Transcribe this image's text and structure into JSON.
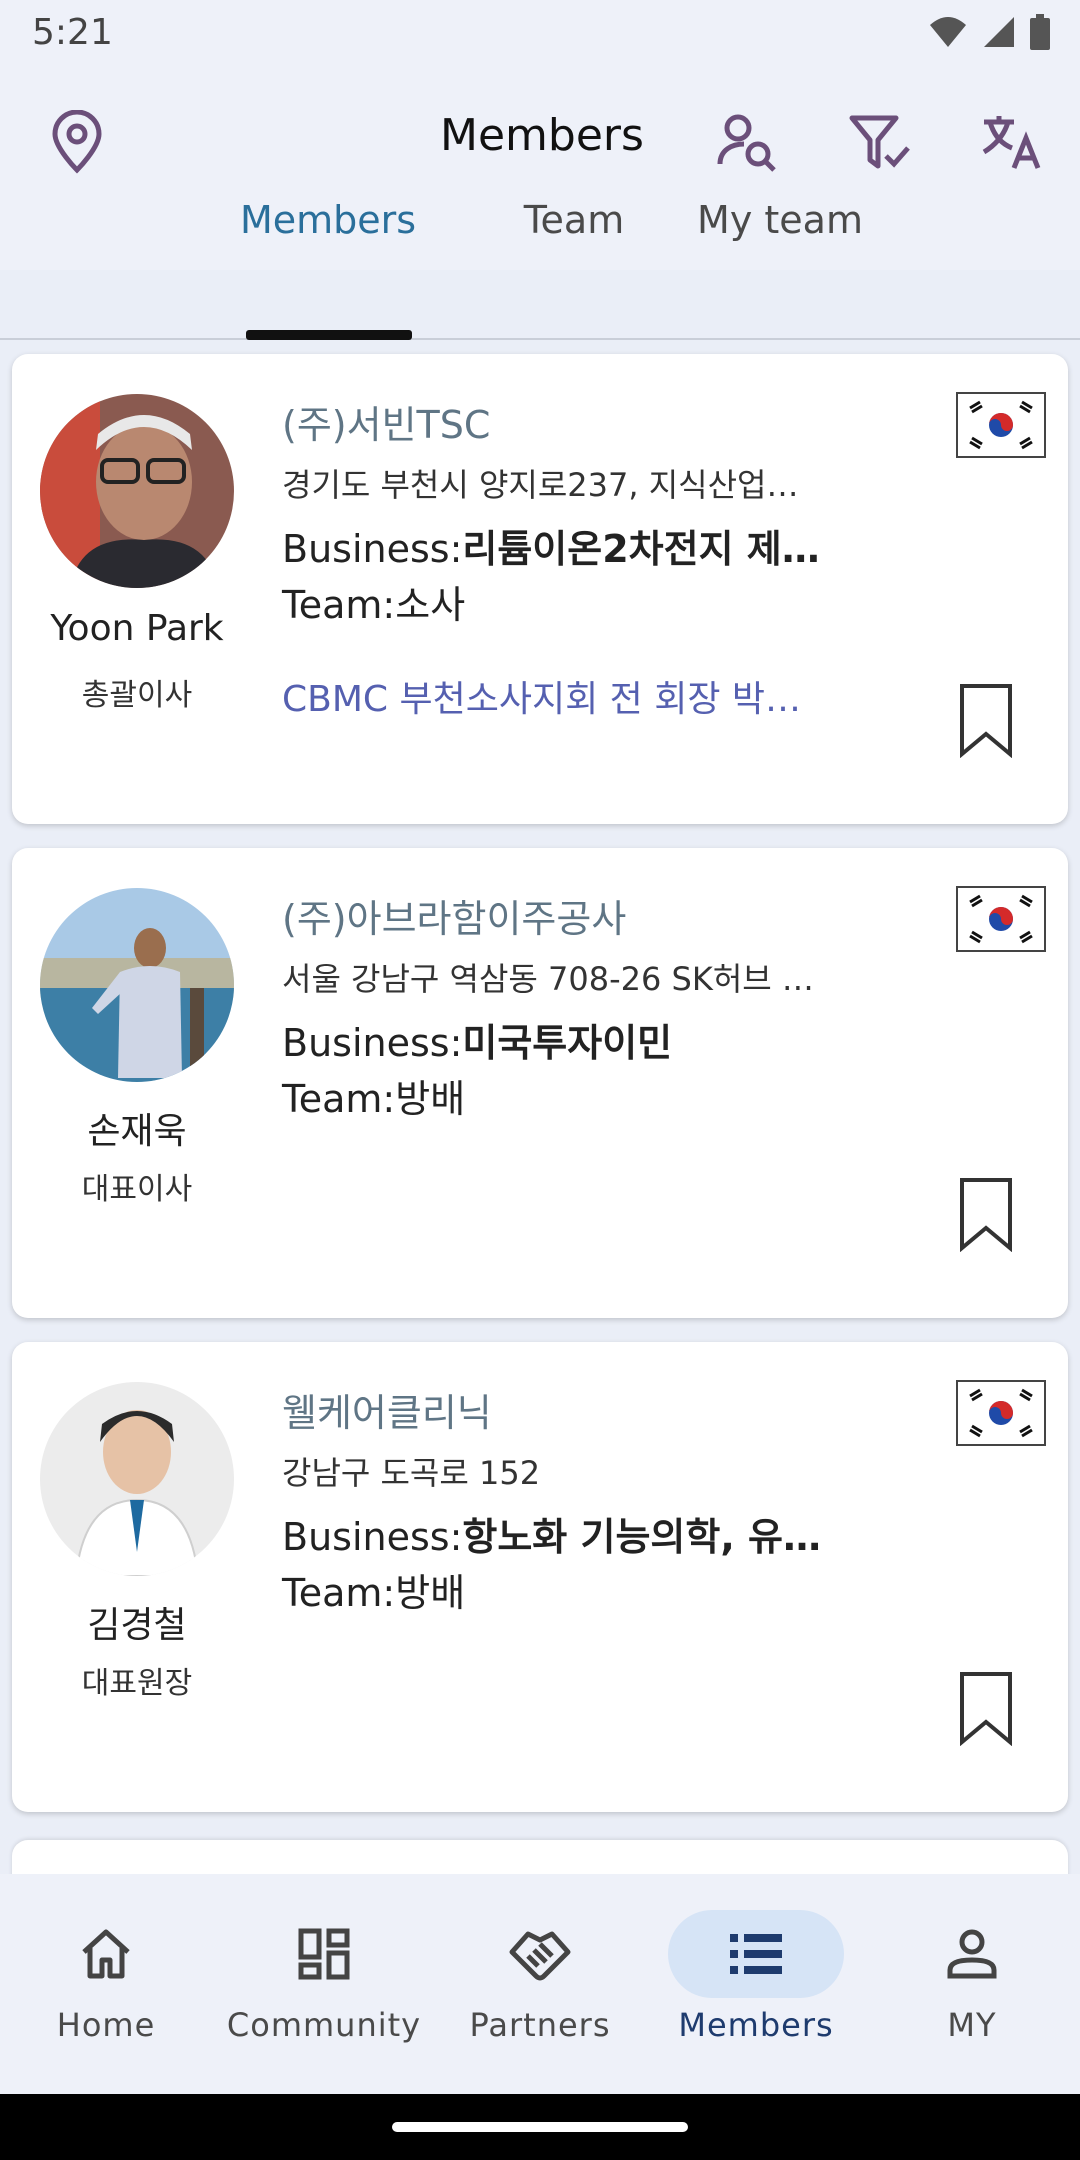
{
  "status_bar": {
    "time": "5:21",
    "icons": [
      "wifi-icon",
      "signal-icon",
      "battery-icon"
    ]
  },
  "app_bar": {
    "title": "Members",
    "actions": [
      "location-pin-icon",
      "person-search-icon",
      "filter-check-icon",
      "translate-icon"
    ]
  },
  "tabs": [
    {
      "label": "Members",
      "active": true
    },
    {
      "label": "Team",
      "active": false
    },
    {
      "label": "My team",
      "active": false
    }
  ],
  "members": [
    {
      "name": "Yoon Park",
      "role": "총괄이사",
      "company": "(주)서빈TSC",
      "address": "경기도 부천시 양지로237, 지식산업…",
      "business_label": "Business:",
      "business": "리튬이온2차전지 제…",
      "team_label": "Team:",
      "team": "소사",
      "tags": "CBMC  부천소사지회 전 회장 박…",
      "country_flag": "korea-flag-icon"
    },
    {
      "name": "손재욱",
      "role": "대표이사",
      "company": "(주)아브라함이주공사",
      "address": "서울 강남구 역삼동 708-26 SK허브 …",
      "business_label": "Business:",
      "business": "미국투자이민",
      "team_label": "Team:",
      "team": "방배",
      "tags": "",
      "country_flag": "korea-flag-icon"
    },
    {
      "name": "김경철",
      "role": "대표원장",
      "company": "웰케어클리닉",
      "address": "강남구 도곡로 152",
      "business_label": "Business:",
      "business": "항노화 기능의학, 유…",
      "team_label": "Team:",
      "team": "방배",
      "tags": "",
      "country_flag": "korea-flag-icon"
    }
  ],
  "bottom_nav": [
    {
      "label": "Home",
      "icon": "home-icon",
      "active": false
    },
    {
      "label": "Community",
      "icon": "dashboard-icon",
      "active": false
    },
    {
      "label": "Partners",
      "icon": "handshake-icon",
      "active": false
    },
    {
      "label": "Members",
      "icon": "list-icon",
      "active": true
    },
    {
      "label": "MY",
      "icon": "person-icon",
      "active": false
    }
  ],
  "colors": {
    "accent": "#2a6f9b",
    "background": "#eaeef7",
    "tag": "#5560b0",
    "nav_active_bg": "#d6e4f6"
  }
}
